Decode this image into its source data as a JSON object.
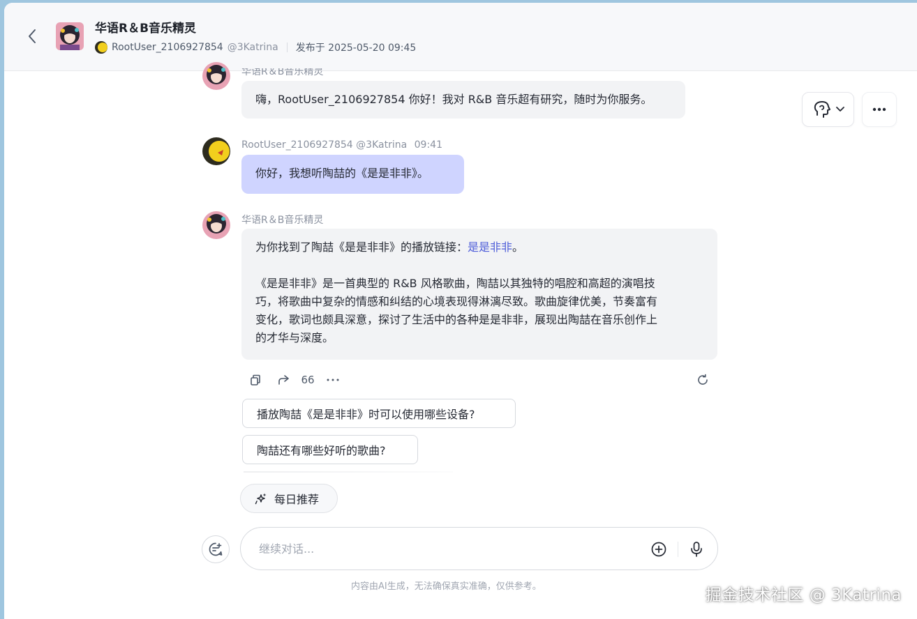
{
  "header": {
    "title": "华语R＆B音乐精灵",
    "author": "RootUser_2106927854",
    "handle": "@3Katrina",
    "published": "发布于 2025-05-20 09:45"
  },
  "messages": [
    {
      "role": "bot",
      "name": "华语R＆B音乐精灵",
      "text": "嗨，RootUser_2106927854 你好！我对 R&B 音乐超有研究，随时为你服务。"
    },
    {
      "role": "user",
      "name": "RootUser_2106927854",
      "handle": "@3Katrina",
      "time": "09:41",
      "text": "你好，我想听陶喆的《是是非非》。"
    },
    {
      "role": "bot",
      "name": "华语R＆B音乐精灵",
      "intro": "为你找到了陶喆《是是非非》的播放链接：",
      "link": "是是非非",
      "intro_end": "。",
      "lines": [
        "《是是非非》是一首典型的 R&B 风格歌曲，陶喆以其独特的唱腔和高超的演唱技",
        "巧，将歌曲中复杂的情感和纠结的心境表现得淋漓尽致。歌曲旋律优美，节奏富有",
        "变化，歌词也颇具深意，探讨了生活中的各种是是非非，展现出陶喆在音乐创作上",
        "的才华与深度。"
      ]
    }
  ],
  "actions": {
    "quote_count": "66"
  },
  "suggestions": [
    "播放陶喆《是是非非》时可以使用哪些设备?",
    "陶喆还有哪些好听的歌曲?"
  ],
  "daily": "每日推荐",
  "input": {
    "placeholder": "继续对话..."
  },
  "disclaimer": "内容由AI生成，无法确保真实准确，仅供参考。",
  "watermark": "掘金技术社区 @ 3Katrina",
  "colors": {
    "user_bubble": "#cfd4ff",
    "bot_bubble": "#f2f3f5",
    "link": "#4f5ed9"
  }
}
